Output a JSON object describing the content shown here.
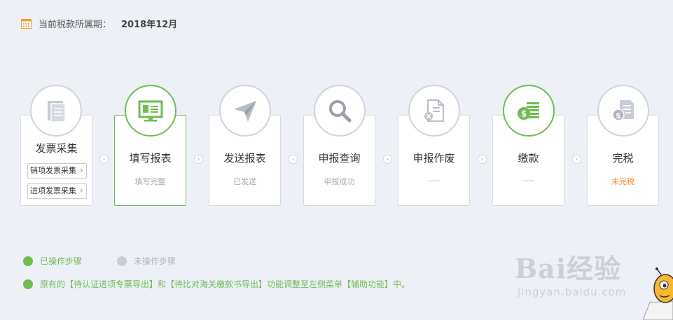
{
  "period": {
    "label": "当前税款所属期：",
    "value": "2018年12月",
    "icon": "calendar-icon",
    "icon_color": "#f0a030"
  },
  "steps": [
    {
      "title": "发票采集",
      "icon": "documents-icon",
      "active": false,
      "buttons": [
        "销项发票采集",
        "进项发票采集"
      ]
    },
    {
      "title": "填写报表",
      "status": "填写完整",
      "icon": "monitor-report-icon",
      "active": true
    },
    {
      "title": "发送报表",
      "status": "已发送",
      "icon": "paper-plane-icon",
      "active": false
    },
    {
      "title": "申报查询",
      "status": "申报成功",
      "icon": "magnifier-icon",
      "active": false
    },
    {
      "title": "申报作废",
      "status": "----",
      "icon": "document-cancel-icon",
      "active": false
    },
    {
      "title": "缴款",
      "status": "----",
      "icon": "money-icon",
      "active": true
    },
    {
      "title": "完税",
      "status": "未完税",
      "icon": "tax-document-icon",
      "active": false
    }
  ],
  "legend": {
    "done": "已操作步骤",
    "todo": "未操作步骤"
  },
  "notice": "原有的【待认证进项专票导出】和【待比对海关缴款书导出】功能调整至左侧菜单【辅助功能】中。",
  "watermark": {
    "main": "Bai经验",
    "sub": "jingyan.baidu.com"
  },
  "colors": {
    "green": "#6ebc52",
    "gray": "#c9ced6",
    "orange": "#f08a3c",
    "background": "#eef0f7"
  }
}
